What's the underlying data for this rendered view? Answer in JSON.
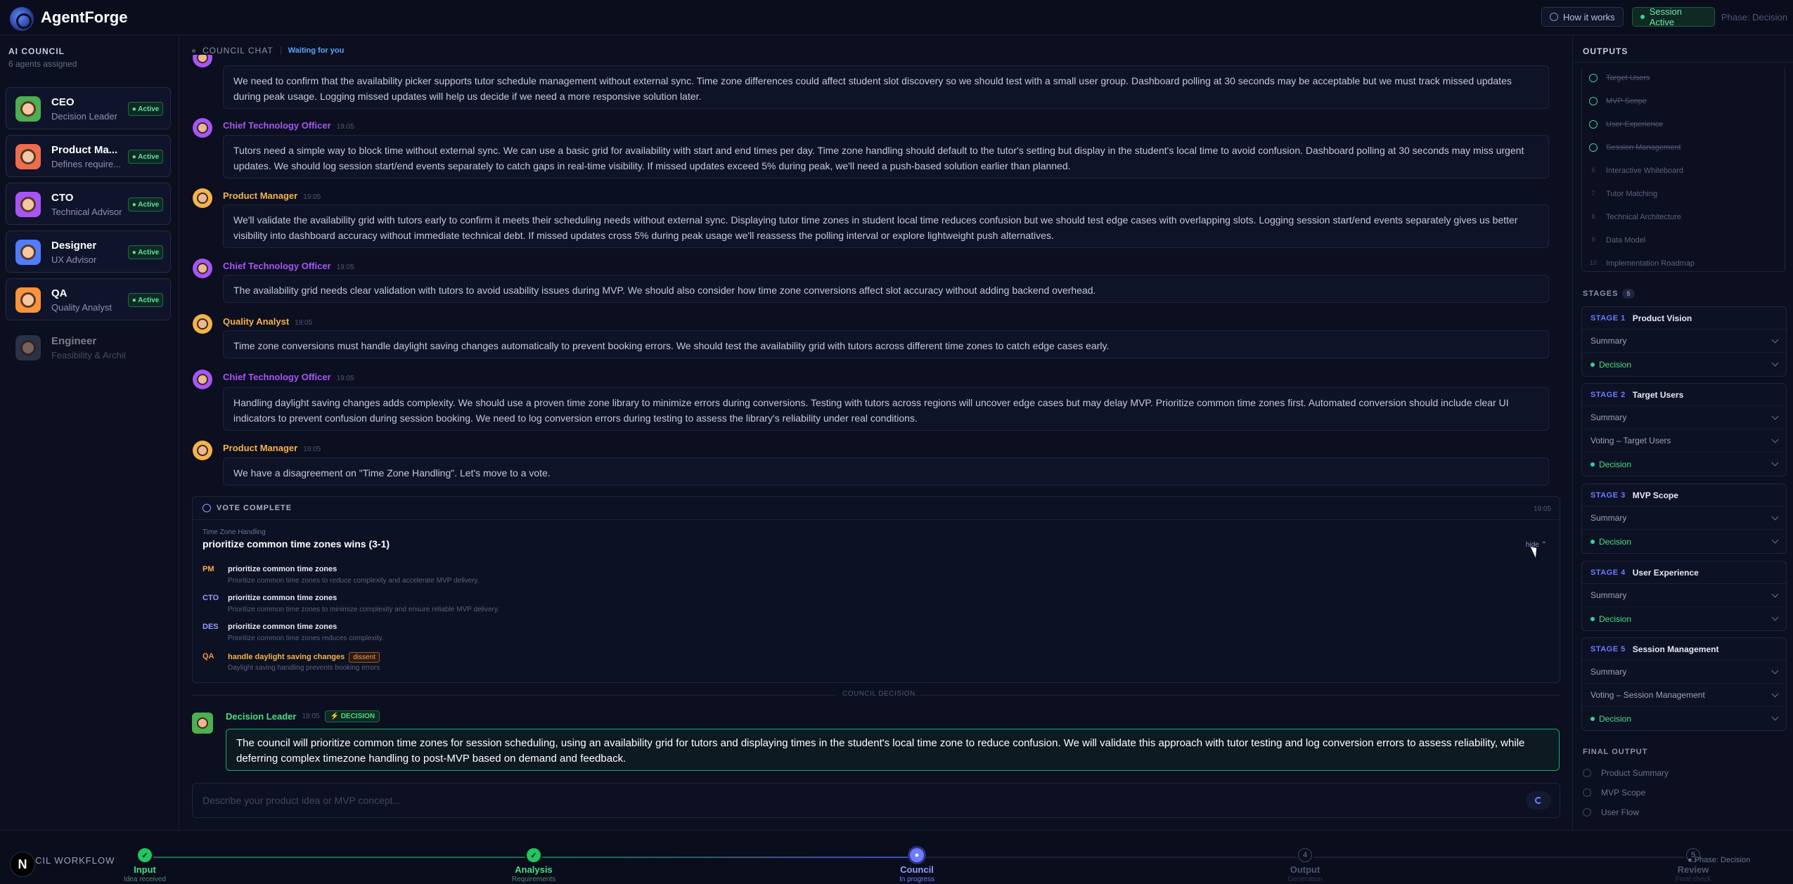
{
  "app": {
    "name": "AgentForge"
  },
  "top": {
    "how_label": "How it works",
    "session_label": "Session Active",
    "phase_label": "Phase: Decision"
  },
  "sidebar": {
    "title": "AI COUNCIL",
    "subtitle": "6 agents assigned",
    "active_label": "● Active",
    "agents": [
      {
        "name": "CEO",
        "role": "Decision Leader",
        "color": "#4caf50",
        "active": true
      },
      {
        "name": "Product Ma...",
        "role": "Defines require...",
        "color": "#f06c4d",
        "active": true
      },
      {
        "name": "CTO",
        "role": "Technical Advisor",
        "color": "#a855f7",
        "active": true
      },
      {
        "name": "Designer",
        "role": "UX Advisor",
        "color": "#4f7dff",
        "active": true
      },
      {
        "name": "QA",
        "role": "Quality Analyst",
        "color": "#fb923c",
        "active": true
      },
      {
        "name": "Engineer",
        "role": "Feasibility & Architect",
        "color": "#555d74",
        "active": false
      }
    ]
  },
  "chat": {
    "title": "COUNCIL CHAT",
    "status": "Waiting for you",
    "messages": [
      {
        "sender": "",
        "time": "",
        "color": "#a855f7",
        "text": "We need to confirm that the availability picker supports tutor schedule management without external sync. Time zone differences could affect student slot discovery so we should test with a small user group. Dashboard polling at 30 seconds may be acceptable but we must track missed updates during peak usage. Logging missed updates will help us decide if we need a more responsive solution later."
      },
      {
        "sender": "Chief Technology Officer",
        "time": "19:05",
        "color": "#a855f7",
        "text": "Tutors need a simple way to block time without external sync. We can use a basic grid for availability with start and end times per day. Time zone handling should default to the tutor's setting but display in the student's local time to avoid confusion. Dashboard polling at 30 seconds may miss urgent updates. We should log session start/end events separately to catch gaps in real-time visibility. If missed updates exceed 5% during peak, we'll need a push-based solution earlier than planned."
      },
      {
        "sender": "Product Manager",
        "time": "19:05",
        "color": "#f5b24a",
        "text": "We'll validate the availability grid with tutors early to confirm it meets their scheduling needs without external sync. Displaying tutor time zones in student local time reduces confusion but we should test edge cases with overlapping slots. Logging session start/end events separately gives us better visibility into dashboard accuracy without immediate technical debt. If missed updates cross 5% during peak usage we'll reassess the polling interval or explore lightweight push alternatives."
      },
      {
        "sender": "Chief Technology Officer",
        "time": "19:05",
        "color": "#a855f7",
        "text": "The availability grid needs clear validation with tutors to avoid usability issues during MVP. We should also consider how time zone conversions affect slot accuracy without adding backend overhead."
      },
      {
        "sender": "Quality Analyst",
        "time": "19:05",
        "color": "#f5b24a",
        "text": "Time zone conversions must handle daylight saving changes automatically to prevent booking errors. We should test the availability grid with tutors across different time zones to catch edge cases early."
      },
      {
        "sender": "Chief Technology Officer",
        "time": "19:05",
        "color": "#a855f7",
        "text": "Handling daylight saving changes adds complexity. We should use a proven time zone library to minimize errors during conversions. Testing with tutors across regions will uncover edge cases but may delay MVP. Prioritize common time zones first. Automated conversion should include clear UI indicators to prevent confusion during session booking. We need to log conversion errors during testing to assess the library's reliability under real conditions."
      },
      {
        "sender": "Product Manager",
        "time": "19:05",
        "color": "#f5b24a",
        "text": "We have a disagreement on \"Time Zone Handling\". Let's move to a vote."
      }
    ]
  },
  "vote": {
    "heading": "VOTE COMPLETE",
    "time": "19:05",
    "topic": "Time Zone Handling",
    "result": "prioritize common time zones wins (3-1)",
    "hide_label": "hide ⌃",
    "voters": [
      {
        "code": "PM",
        "color": "#f5b24a",
        "choice": "prioritize common time zones",
        "reason": "Prioritize common time zones to reduce complexity and accelerate MVP delivery.",
        "dissent": ""
      },
      {
        "code": "CTO",
        "color": "#8fa0ff",
        "choice": "prioritize common time zones",
        "reason": "Prioritize common time zones to minimize complexity and ensure reliable MVP delivery.",
        "dissent": ""
      },
      {
        "code": "DES",
        "color": "#8fa0ff",
        "choice": "prioritize common time zones",
        "reason": "Prioritize common time zones reduces complexity.",
        "dissent": ""
      },
      {
        "code": "QA",
        "color": "#fb923c",
        "choice": "handle daylight saving changes",
        "reason": "Daylight saving handling prevents booking errors",
        "dissent": "dissent"
      }
    ]
  },
  "decision": {
    "separator": "COUNCIL DECISION",
    "sender": "Decision Leader",
    "time": "19:05",
    "badge": "⚡ DECISION",
    "text": "The council will prioritize common time zones for session scheduling, using an availability grid for tutors and displaying times in the student's local time zone to reduce confusion. We will validate this approach with tutor testing and log conversion errors to assess reliability, while deferring complex timezone handling to post-MVP based on demand and feedback."
  },
  "input": {
    "placeholder": "Describe your product idea or MVP concept..."
  },
  "outputs": {
    "title": "OUTPUTS",
    "items": [
      {
        "num": "",
        "label": "Target Users",
        "done": true
      },
      {
        "num": "",
        "label": "MVP Scope",
        "done": true
      },
      {
        "num": "",
        "label": "User Experience",
        "done": true
      },
      {
        "num": "",
        "label": "Session Management",
        "done": true
      },
      {
        "num": "6",
        "label": "Interactive Whiteboard",
        "done": false
      },
      {
        "num": "7",
        "label": "Tutor Matching",
        "done": false
      },
      {
        "num": "8",
        "label": "Technical Architecture",
        "done": false
      },
      {
        "num": "9",
        "label": "Data Model",
        "done": false
      },
      {
        "num": "10",
        "label": "Implementation Roadmap",
        "done": false
      }
    ]
  },
  "stages": {
    "title": "STAGES",
    "count": "5",
    "items": [
      {
        "num": "STAGE 1",
        "name": "Product Vision",
        "rows": [
          {
            "label": "Summary",
            "decision": false
          },
          {
            "label": "Decision",
            "decision": true
          }
        ]
      },
      {
        "num": "STAGE 2",
        "name": "Target Users",
        "rows": [
          {
            "label": "Summary",
            "decision": false
          },
          {
            "label": "Voting – Target Users",
            "decision": false
          },
          {
            "label": "Decision",
            "decision": true
          }
        ]
      },
      {
        "num": "STAGE 3",
        "name": "MVP Scope",
        "rows": [
          {
            "label": "Summary",
            "decision": false
          },
          {
            "label": "Decision",
            "decision": true
          }
        ]
      },
      {
        "num": "STAGE 4",
        "name": "User Experience",
        "rows": [
          {
            "label": "Summary",
            "decision": false
          },
          {
            "label": "Decision",
            "decision": true
          }
        ]
      },
      {
        "num": "STAGE 5",
        "name": "Session Management",
        "rows": [
          {
            "label": "Summary",
            "decision": false
          },
          {
            "label": "Voting – Session Management",
            "decision": false
          },
          {
            "label": "Decision",
            "decision": true
          }
        ]
      }
    ]
  },
  "final_output": {
    "title": "FINAL OUTPUT",
    "items": [
      "Product Summary",
      "MVP Scope",
      "User Flow"
    ]
  },
  "workflow": {
    "label": "CIL WORKFLOW",
    "avatar": "N",
    "phase": "● Phase: Decision",
    "steps": [
      {
        "name": "Input",
        "sub": "Idea received",
        "state": "done",
        "mark": "✓"
      },
      {
        "name": "Analysis",
        "sub": "Requirements",
        "state": "done",
        "mark": "✓"
      },
      {
        "name": "Council",
        "sub": "In progress",
        "state": "current",
        "mark": "●"
      },
      {
        "name": "Output",
        "sub": "Generation",
        "state": "todo",
        "mark": "4"
      },
      {
        "name": "Review",
        "sub": "Final check",
        "state": "todo",
        "mark": "5"
      }
    ]
  }
}
